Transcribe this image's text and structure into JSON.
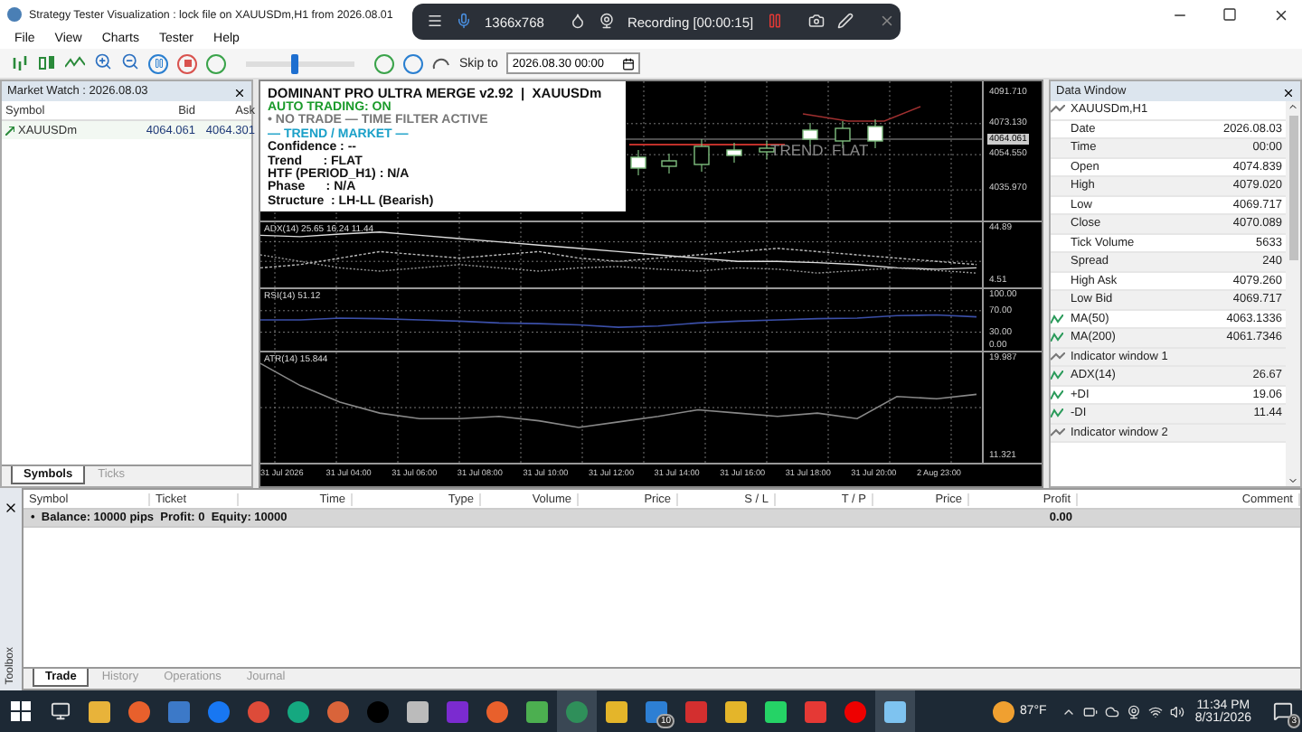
{
  "window": {
    "title": "Strategy Tester Visualization : lock file on XAUUSDm,H1 from 2026.08.01"
  },
  "recorder": {
    "resolution": "1366x768",
    "status": "Recording [00:00:15]"
  },
  "menu": [
    "File",
    "View",
    "Charts",
    "Tester",
    "Help"
  ],
  "toolbar": {
    "speed": {
      "level": 0.45
    },
    "skip_label": "Skip to",
    "skip_date": "2026.08.30 00:00"
  },
  "market_watch": {
    "title": "Market Watch : 2026.08.03",
    "columns": [
      "Symbol",
      "Bid",
      "Ask"
    ],
    "rows": [
      {
        "symbol": "XAUUSDm",
        "bid": "4064.061",
        "ask": "4064.301"
      }
    ],
    "tabs": [
      {
        "label": "Symbols",
        "selected": true
      },
      {
        "label": "Ticks",
        "selected": false
      }
    ]
  },
  "chart": {
    "info_panel": {
      "title": "DOMINANT PRO ULTRA MERGE v2.92  |  XAUUSDm",
      "lines": [
        {
          "kind": "status",
          "text": "AUTO TRADING: ON"
        },
        {
          "kind": "warning",
          "text": "• NO TRADE — TIME FILTER ACTIVE"
        },
        {
          "kind": "heading",
          "text": "— TREND / MARKET —"
        },
        {
          "kind": "field",
          "text": "Confidence : --"
        },
        {
          "kind": "field",
          "text": "Trend      : FLAT"
        },
        {
          "kind": "field",
          "text": "HTF (PERIOD_H1) : N/A"
        },
        {
          "kind": "field",
          "text": "Phase      : N/A"
        },
        {
          "kind": "field",
          "text": "Structure  : LH-LL (Bearish)"
        }
      ]
    },
    "trend_label": "TREND: FLAT",
    "price_ticks": [
      "4091.710",
      "4073.130",
      "4054.550",
      "4035.970"
    ],
    "current_price": "4064.061",
    "panes": [
      {
        "kind": "adx",
        "label": "ADX(14) 25.65 16.24 11.44",
        "ticks": [
          "44.89",
          "4.51"
        ]
      },
      {
        "kind": "rsi",
        "label": "RSI(14) 51.12",
        "ticks": [
          "100.00",
          "70.00",
          "30.00",
          "0.00"
        ]
      },
      {
        "kind": "atr",
        "label": "ATR(14) 15.844",
        "ticks": [
          "19.987",
          "11.321"
        ]
      }
    ],
    "time_labels": [
      "31 Jul 2026",
      "31 Jul 04:00",
      "31 Jul 06:00",
      "31 Jul 08:00",
      "31 Jul 10:00",
      "31 Jul 12:00",
      "31 Jul 14:00",
      "31 Jul 16:00",
      "31 Jul 18:00",
      "31 Jul 20:00",
      "2 Aug 23:00"
    ]
  },
  "data_window": {
    "title": "Data Window",
    "symbol": "XAUUSDm,H1",
    "rows": [
      {
        "kind": "field",
        "label": "Date",
        "value": "2026.08.03"
      },
      {
        "kind": "field",
        "label": "Time",
        "value": "00:00"
      },
      {
        "kind": "field",
        "label": "Open",
        "value": "4074.839"
      },
      {
        "kind": "field",
        "label": "High",
        "value": "4079.020"
      },
      {
        "kind": "field",
        "label": "Low",
        "value": "4069.717"
      },
      {
        "kind": "field",
        "label": "Close",
        "value": "4070.089"
      },
      {
        "kind": "field",
        "label": "Tick Volume",
        "value": "5633"
      },
      {
        "kind": "field",
        "label": "Spread",
        "value": "240"
      },
      {
        "kind": "field",
        "label": "High Ask",
        "value": "4079.260"
      },
      {
        "kind": "field",
        "label": "Low Bid",
        "value": "4069.717"
      },
      {
        "kind": "indicator",
        "label": "MA(50)",
        "value": "4063.1336"
      },
      {
        "kind": "indicator",
        "label": "MA(200)",
        "value": "4061.7346"
      },
      {
        "kind": "group",
        "label": "Indicator window 1"
      },
      {
        "kind": "indicator",
        "label": "ADX(14)",
        "value": "26.67"
      },
      {
        "kind": "indicator",
        "label": "+DI",
        "value": "19.06"
      },
      {
        "kind": "indicator",
        "label": "-DI",
        "value": "11.44"
      },
      {
        "kind": "group",
        "label": "Indicator window 2"
      }
    ]
  },
  "trade": {
    "columns": [
      "Symbol",
      "Ticket",
      "Time",
      "Type",
      "Volume",
      "Price",
      "S / L",
      "T / P",
      "Price",
      "Profit",
      "Comment"
    ],
    "balance_marker": "•",
    "balance": "Balance: 10000 pips  Profit: 0  Equity: 10000",
    "profit": "0.00",
    "side_label": "Toolbox",
    "tabs": [
      {
        "label": "Trade",
        "selected": true
      },
      {
        "label": "History",
        "selected": false
      },
      {
        "label": "Operations",
        "selected": false
      },
      {
        "label": "Journal",
        "selected": false
      }
    ]
  },
  "taskbar": {
    "mail_badge": "10",
    "temperature": "87°F",
    "time": "11:34 PM",
    "date": "8/31/2026",
    "notifications": "3"
  }
}
